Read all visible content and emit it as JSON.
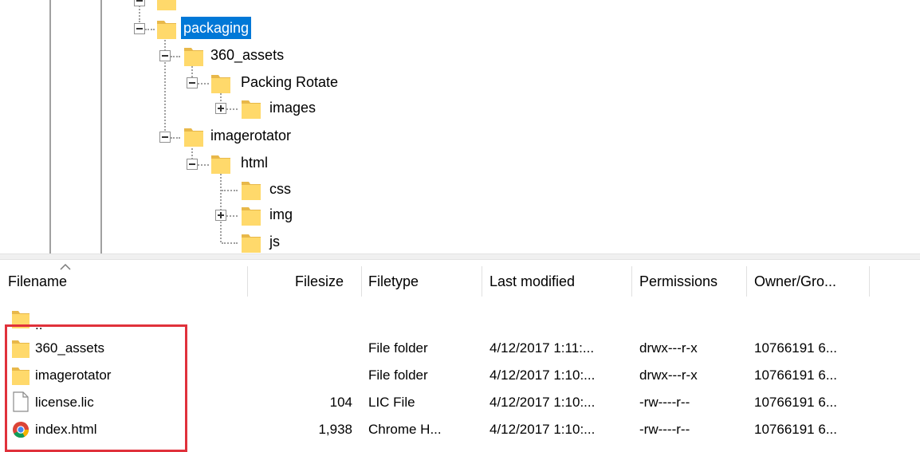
{
  "tree": {
    "nodes": [
      {
        "id": "partial",
        "label": "",
        "selected": false
      },
      {
        "id": "packaging",
        "label": "packaging",
        "selected": true
      },
      {
        "id": "360_assets",
        "label": "360_assets",
        "selected": false
      },
      {
        "id": "packing_rotate",
        "label": "Packing Rotate",
        "selected": false
      },
      {
        "id": "images",
        "label": "images",
        "selected": false
      },
      {
        "id": "imagerotator",
        "label": "imagerotator",
        "selected": false
      },
      {
        "id": "html",
        "label": "html",
        "selected": false
      },
      {
        "id": "css",
        "label": "css",
        "selected": false
      },
      {
        "id": "img",
        "label": "img",
        "selected": false
      },
      {
        "id": "js",
        "label": "js",
        "selected": false
      }
    ]
  },
  "list": {
    "columns": {
      "filename": "Filename",
      "filesize": "Filesize",
      "filetype": "Filetype",
      "last_modified": "Last modified",
      "permissions": "Permissions",
      "owner_group": "Owner/Gro..."
    },
    "sort_column": "filename",
    "rows": [
      {
        "name": "..",
        "size": "",
        "type": "",
        "modified": "",
        "perms": "",
        "owner": "",
        "icon": "folder-icon"
      },
      {
        "name": "360_assets",
        "size": "",
        "type": "File folder",
        "modified": "4/12/2017 1:11:...",
        "perms": "drwx---r-x",
        "owner": "10766191 6...",
        "icon": "folder-icon"
      },
      {
        "name": "imagerotator",
        "size": "",
        "type": "File folder",
        "modified": "4/12/2017 1:10:...",
        "perms": "drwx---r-x",
        "owner": "10766191 6...",
        "icon": "folder-icon"
      },
      {
        "name": "license.lic",
        "size": "104",
        "type": "LIC File",
        "modified": "4/12/2017 1:10:...",
        "perms": "-rw----r--",
        "owner": "10766191 6...",
        "icon": "document-icon"
      },
      {
        "name": "index.html",
        "size": "1,938",
        "type": "Chrome H...",
        "modified": "4/12/2017 1:10:...",
        "perms": "-rw----r--",
        "owner": "10766191 6...",
        "icon": "chrome-icon"
      }
    ]
  },
  "colors": {
    "selection": "#0078d7",
    "folder": "#ffd96b",
    "highlight_box": "#e0313b"
  }
}
